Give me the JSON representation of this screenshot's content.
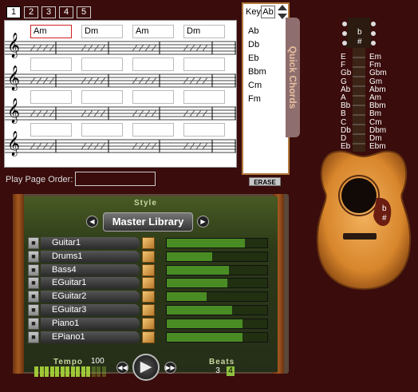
{
  "pages": [
    "1",
    "2",
    "3",
    "4",
    "5"
  ],
  "active_page": "1",
  "staff_rows": [
    {
      "chords": [
        "Am",
        "Dm",
        "Am",
        "Dm"
      ]
    },
    {
      "chords": [
        "",
        "",
        "",
        ""
      ]
    },
    {
      "chords": [
        "",
        "",
        "",
        ""
      ]
    },
    {
      "chords": [
        "",
        "",
        "",
        ""
      ]
    }
  ],
  "play_page_order": {
    "label": "Play Page Order:",
    "value": ""
  },
  "key": {
    "label": "Key",
    "value": "Ab"
  },
  "quick_chords": {
    "tab_label": "Quick Chords",
    "items": [
      "Ab",
      "Db",
      "Eb",
      "Bbm",
      "Cm",
      "Fm"
    ]
  },
  "erase_label": "ERASE",
  "guitar": {
    "major_chords": [
      "E",
      "F",
      "Gb",
      "G",
      "Ab",
      "A",
      "Bb",
      "B",
      "C",
      "Db",
      "D",
      "Eb"
    ],
    "minor_chords": [
      "Em",
      "Fm",
      "Gbm",
      "Gm",
      "Abm",
      "Am",
      "Bbm",
      "Bm",
      "Cm",
      "Dbm",
      "Dm",
      "Ebm"
    ],
    "headstock_flat": "b",
    "headstock_sharp": "#",
    "body_flat": "b",
    "body_sharp": "#"
  },
  "style": {
    "label": "Style",
    "library_name": "Master Library",
    "tracks": [
      {
        "name": "Guitar1",
        "level": 0.78
      },
      {
        "name": "Drums1",
        "level": 0.45
      },
      {
        "name": "Bass4",
        "level": 0.62
      },
      {
        "name": "EGuitar1",
        "level": 0.6
      },
      {
        "name": "EGuitar2",
        "level": 0.4
      },
      {
        "name": "EGuitar3",
        "level": 0.65
      },
      {
        "name": "Piano1",
        "level": 0.75
      },
      {
        "name": "EPiano1",
        "level": 0.75
      }
    ]
  },
  "tempo": {
    "label": "Tempo",
    "value": "100"
  },
  "beats": {
    "label": "Beats",
    "options": [
      "3",
      "4"
    ],
    "selected": "4"
  },
  "colors": {
    "background": "#3a0c0c",
    "panel_green": "#485a24",
    "meter": "#4a8c24",
    "wood": "#a4581f"
  }
}
